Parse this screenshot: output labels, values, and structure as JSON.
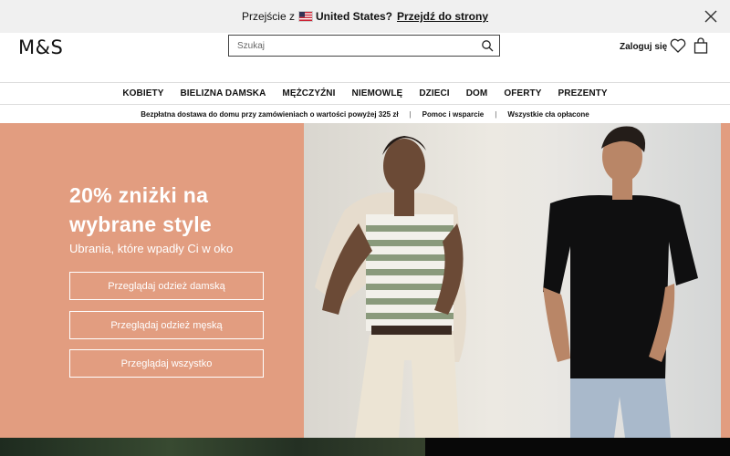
{
  "geo_banner": {
    "prefix": "Przejście z",
    "country": "United States?",
    "link": "Przejdź do strony",
    "flag_icon": "us-flag-icon",
    "close_icon": "close-icon"
  },
  "header": {
    "logo": "M&S",
    "search_placeholder": "Szukaj",
    "search_icon": "search-icon",
    "login": "Zaloguj się",
    "wishlist_icon": "heart-icon",
    "bag_icon": "shopping-bag-icon"
  },
  "nav": {
    "items": [
      "KOBIETY",
      "BIELIZNA DAMSKA",
      "MĘŻCZYŹNI",
      "NIEMOWLĘ",
      "DZIECI",
      "DOM",
      "OFERTY",
      "PREZENTY"
    ]
  },
  "usp": {
    "items": [
      "Bezpłatna dostawa do domu przy zamówieniach o wartości powyżej 325 zł",
      "Pomoc i wsparcie",
      "Wszystkie cła opłacone"
    ]
  },
  "hero": {
    "title": "20% zniżki na wybrane style",
    "subtitle": "Ubrania, które wpadły Ci w oko",
    "buttons": [
      "Przeglądaj odzież damską",
      "Przeglądaj odzież męską",
      "Przeglądaj wszystko"
    ],
    "background_color": "#e29d80"
  },
  "colors": {
    "banner_bg": "#f0f0f0",
    "text": "#111111"
  }
}
